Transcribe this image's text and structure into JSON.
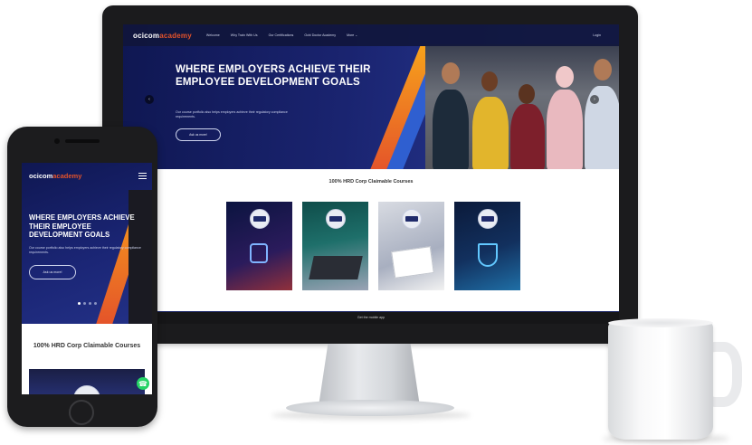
{
  "brand": {
    "logo_prefix": "ocicom",
    "logo_suffix": "academy",
    "primary_color": "#1a2470",
    "accent_color": "#e4532a"
  },
  "desktop": {
    "nav": {
      "links": [
        "Welcome",
        "Why Train With Us",
        "Our Certifications",
        "Ocbi Doctor Academy",
        "More ⌄"
      ],
      "login": "Login"
    },
    "hero": {
      "title": "WHERE EMPLOYERS ACHIEVE THEIR EMPLOYEE DEVELOPMENT GOALS",
      "subtitle": "Our course portfolio also helps employers achieve their regulatory compliance requirements.",
      "button": "Ask us more!",
      "prev_icon": "chevron-left-icon",
      "next_icon": "chevron-right-icon"
    },
    "courses": {
      "heading": "100% HRD Corp Claimable Courses",
      "cards": [
        {
          "badge": "HRD Corp Claimable",
          "theme": "cyber-lock"
        },
        {
          "badge": "HRD Corp Claimable",
          "theme": "laptop-typing"
        },
        {
          "badge": "HRD Corp Claimable",
          "theme": "business-documents"
        },
        {
          "badge": "HRD Corp Claimable",
          "theme": "digital-shield"
        }
      ]
    },
    "footer": "Get the mobile app"
  },
  "mobile": {
    "hero": {
      "title": "WHERE EMPLOYERS ACHIEVE THEIR EMPLOYEE DEVELOPMENT GOALS",
      "subtitle": "Our course portfolio also helps employers achieve their regulatory compliance requirements.",
      "button": "Ask us more!"
    },
    "heading": "100% HRD Corp Claimable Courses",
    "menu_icon": "hamburger-menu-icon",
    "chat_icon": "whatsapp-icon"
  }
}
